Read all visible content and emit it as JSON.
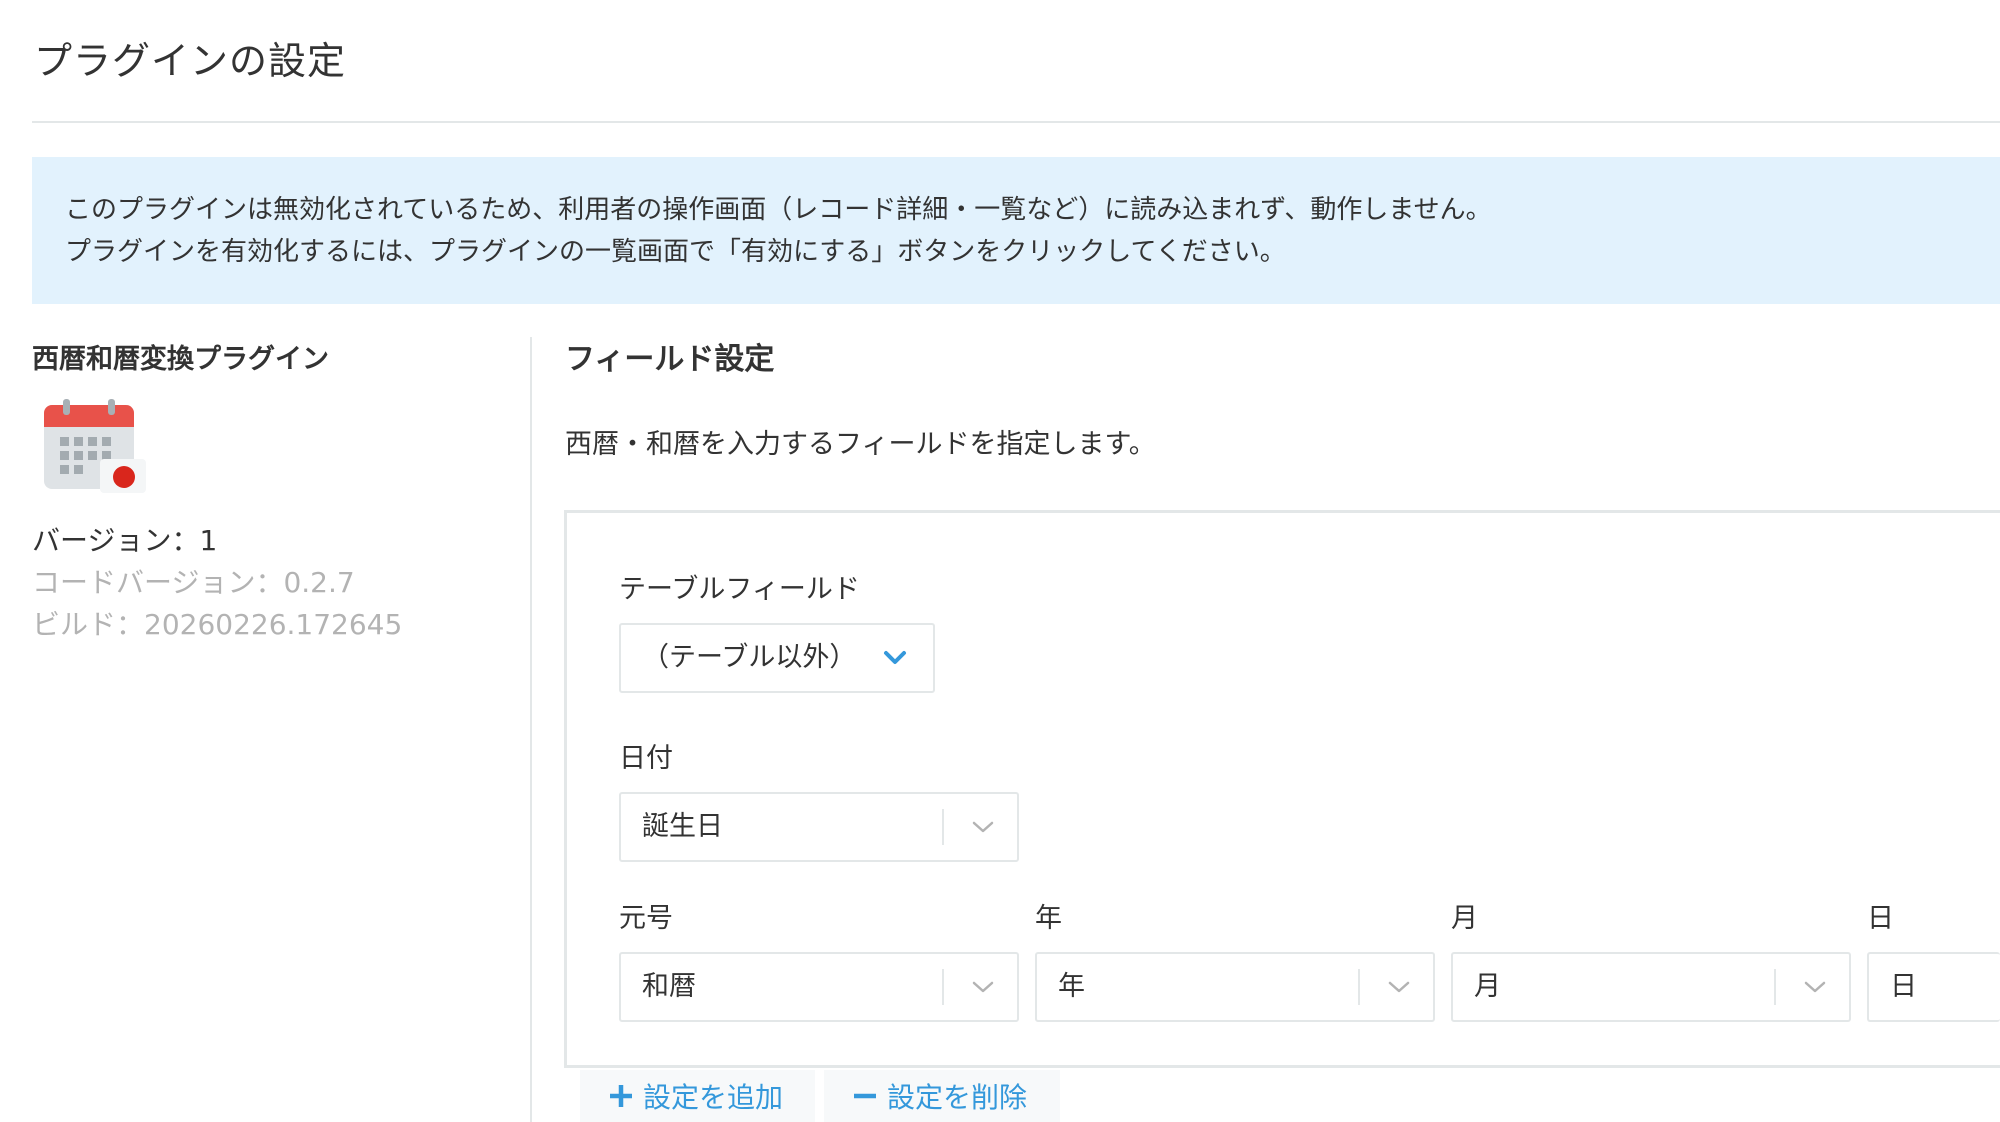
{
  "page": {
    "title": "プラグインの設定"
  },
  "notice": {
    "line1": "このプラグインは無効化されているため、利用者の操作画面（レコード詳細・一覧など）に読み込まれず、動作しません。",
    "line2": "プラグインを有効化するには、プラグインの一覧画面で「有効にする」ボタンをクリックしてください。"
  },
  "plugin": {
    "name": "西暦和暦変換プラグイン",
    "icon": "calendar-icon",
    "version": "バージョン：1",
    "code_version": "コードバージョン：0.2.7",
    "build": "ビルド：20260226.172645"
  },
  "field_settings": {
    "title": "フィールド設定",
    "description": "西暦・和暦を入力するフィールドを指定します。",
    "table_field": {
      "label": "テーブルフィールド",
      "value": "（テーブル以外）"
    },
    "date": {
      "label": "日付",
      "value": "誕生日"
    },
    "era": {
      "label": "元号",
      "value": "和暦"
    },
    "year": {
      "label": "年",
      "value": "年"
    },
    "month": {
      "label": "月",
      "value": "月"
    },
    "day": {
      "label": "日",
      "value": "日"
    }
  },
  "actions": {
    "add_label": "設定を追加",
    "delete_label": "設定を削除"
  },
  "colors": {
    "accent": "#3498db",
    "notice_bg": "#e2f2fd",
    "border": "#e3e7e8",
    "muted_text": "#b3b3b3",
    "text": "#333333"
  }
}
